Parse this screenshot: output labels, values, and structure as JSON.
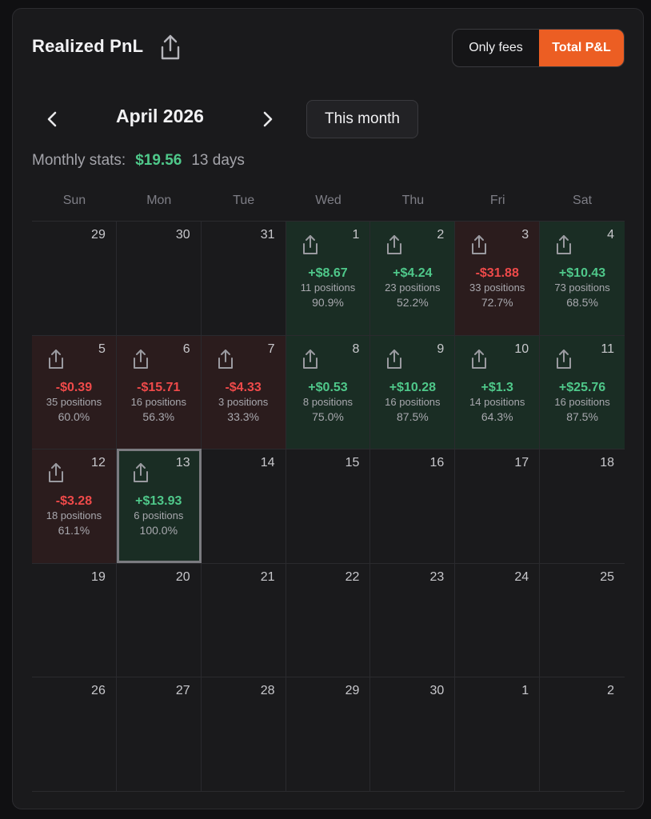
{
  "header": {
    "title": "Realized PnL",
    "share_icon": "share-icon",
    "toggle": {
      "fees_label": "Only fees",
      "total_label": "Total P&L",
      "active": "total"
    }
  },
  "nav": {
    "month_label": "April 2026",
    "prev_icon": "chevron-left-icon",
    "next_icon": "chevron-right-icon",
    "this_month_label": "This month"
  },
  "stats": {
    "label": "Monthly stats:",
    "amount": "$19.56",
    "days": "13 days"
  },
  "weekdays": [
    "Sun",
    "Mon",
    "Tue",
    "Wed",
    "Thu",
    "Fri",
    "Sat"
  ],
  "colors": {
    "accent": "#ec5e23",
    "positive": "#4fc88a",
    "negative": "#ef4a4a",
    "positive_bg": "#1a2d24",
    "negative_bg": "#2b1c1d"
  },
  "days": [
    {
      "day": "29"
    },
    {
      "day": "30"
    },
    {
      "day": "31"
    },
    {
      "day": "1",
      "pnl": "+$8.67",
      "positions": "11 positions",
      "win": "90.9%",
      "state": "pos"
    },
    {
      "day": "2",
      "pnl": "+$4.24",
      "positions": "23 positions",
      "win": "52.2%",
      "state": "pos"
    },
    {
      "day": "3",
      "pnl": "-$31.88",
      "positions": "33 positions",
      "win": "72.7%",
      "state": "neg"
    },
    {
      "day": "4",
      "pnl": "+$10.43",
      "positions": "73 positions",
      "win": "68.5%",
      "state": "pos"
    },
    {
      "day": "5",
      "pnl": "-$0.39",
      "positions": "35 positions",
      "win": "60.0%",
      "state": "neg"
    },
    {
      "day": "6",
      "pnl": "-$15.71",
      "positions": "16 positions",
      "win": "56.3%",
      "state": "neg"
    },
    {
      "day": "7",
      "pnl": "-$4.33",
      "positions": "3 positions",
      "win": "33.3%",
      "state": "neg"
    },
    {
      "day": "8",
      "pnl": "+$0.53",
      "positions": "8 positions",
      "win": "75.0%",
      "state": "pos"
    },
    {
      "day": "9",
      "pnl": "+$10.28",
      "positions": "16 positions",
      "win": "87.5%",
      "state": "pos"
    },
    {
      "day": "10",
      "pnl": "+$1.3",
      "positions": "14 positions",
      "win": "64.3%",
      "state": "pos"
    },
    {
      "day": "11",
      "pnl": "+$25.76",
      "positions": "16 positions",
      "win": "87.5%",
      "state": "pos"
    },
    {
      "day": "12",
      "pnl": "-$3.28",
      "positions": "18 positions",
      "win": "61.1%",
      "state": "neg"
    },
    {
      "day": "13",
      "pnl": "+$13.93",
      "positions": "6 positions",
      "win": "100.0%",
      "state": "pos",
      "today": true
    },
    {
      "day": "14"
    },
    {
      "day": "15"
    },
    {
      "day": "16"
    },
    {
      "day": "17"
    },
    {
      "day": "18"
    },
    {
      "day": "19"
    },
    {
      "day": "20"
    },
    {
      "day": "21"
    },
    {
      "day": "22"
    },
    {
      "day": "23"
    },
    {
      "day": "24"
    },
    {
      "day": "25"
    },
    {
      "day": "26"
    },
    {
      "day": "27"
    },
    {
      "day": "28"
    },
    {
      "day": "29"
    },
    {
      "day": "30"
    },
    {
      "day": "1"
    },
    {
      "day": "2"
    }
  ]
}
